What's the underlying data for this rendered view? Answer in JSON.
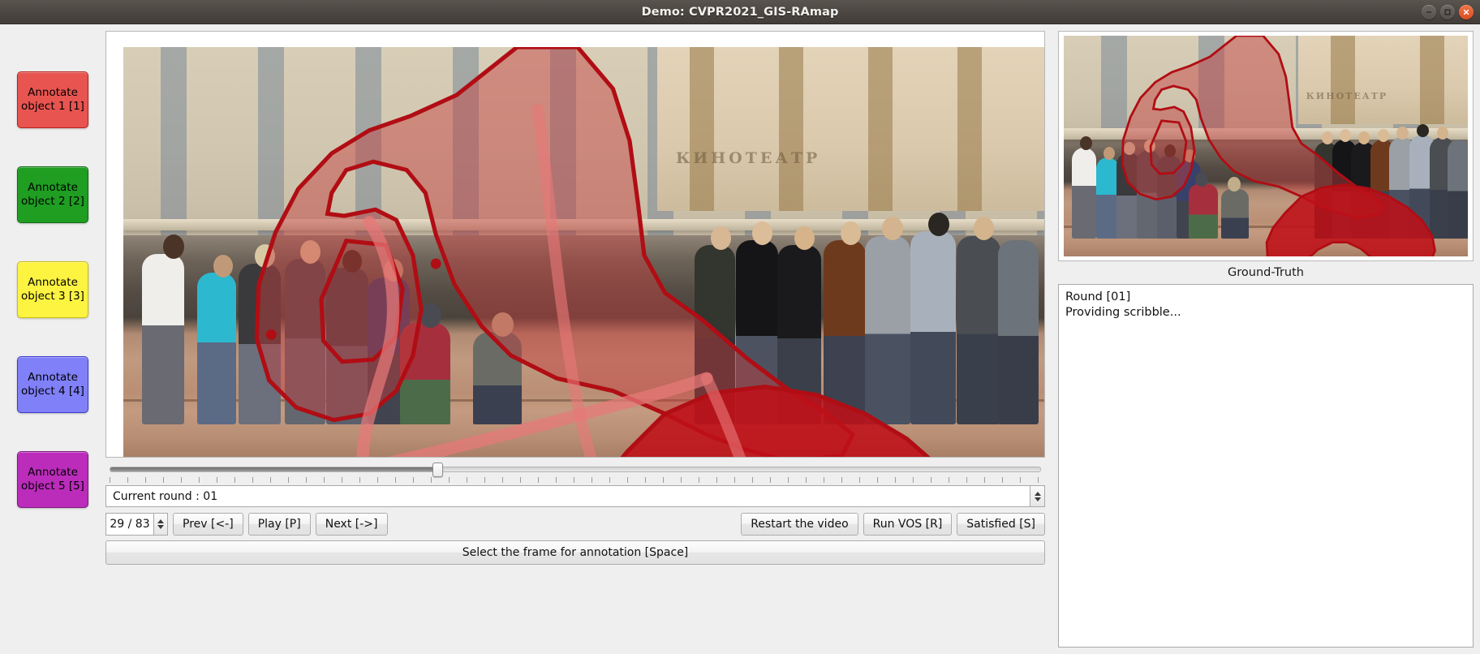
{
  "window": {
    "title": "Demo: CVPR2021_GIS-RAmap",
    "controls": {
      "minimize": "minimize",
      "maximize": "maximize",
      "close": "close"
    }
  },
  "sidebar": {
    "buttons": [
      {
        "label": "Annotate\nobject 1 [1]",
        "line1": "Annotate",
        "line2": "object 1 [1]",
        "color": "#e85450"
      },
      {
        "label": "Annotate\nobject 2 [2]",
        "line1": "Annotate",
        "line2": "object 2 [2]",
        "color": "#1f9e22"
      },
      {
        "label": "Annotate\nobject 3 [3]",
        "line1": "Annotate",
        "line2": "object 3 [3]",
        "color": "#fdf341"
      },
      {
        "label": "Annotate\nobject 4 [4]",
        "line1": "Annotate",
        "line2": "object 4 [4]",
        "color": "#8080f8"
      },
      {
        "label": "Annotate\nobject 5 [5]",
        "line1": "Annotate",
        "line2": "object 5 [5]",
        "color": "#bb2cbb"
      }
    ]
  },
  "center": {
    "slider": {
      "value": 29,
      "min": 1,
      "max": 83,
      "position_percent": 35.3
    },
    "round_combo": {
      "value": "Current round : 01",
      "options": [
        "Current round : 01"
      ]
    },
    "frame_spin": {
      "value": "29 / 83",
      "current": 29,
      "total": 83
    },
    "nav_buttons": [
      {
        "name": "prev",
        "label": "Prev [<-]"
      },
      {
        "name": "play",
        "label": "Play [P]"
      },
      {
        "name": "next",
        "label": "Next [->]"
      }
    ],
    "action_buttons": [
      {
        "name": "restart",
        "label": "Restart the video"
      },
      {
        "name": "run-vos",
        "label": "Run VOS [R]"
      },
      {
        "name": "satisfied",
        "label": "Satisfied [S]"
      }
    ],
    "select_frame_button": "Select the frame for annotation [Space]"
  },
  "right": {
    "ground_truth_label": "Ground-Truth",
    "log": "Round [01]\nProviding scribble..."
  },
  "colors": {
    "titlebar": "#4b4641",
    "titlebar_text": "#f3f1ef",
    "close_button": "#e05a28",
    "panel_bg": "#efefef",
    "mask_red": "#c8101a",
    "mask_outline": "#b00a14"
  }
}
